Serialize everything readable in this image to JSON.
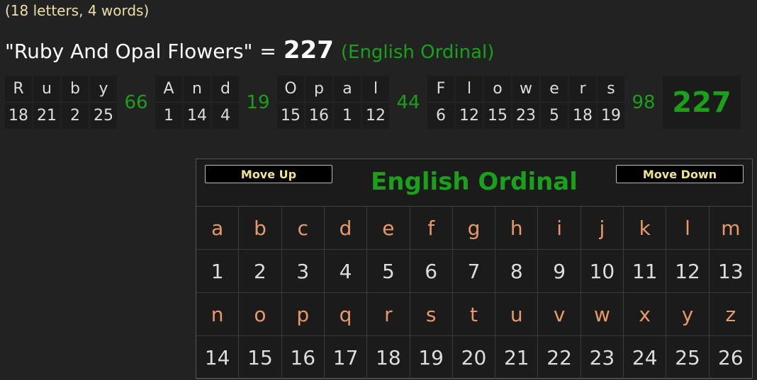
{
  "summary": "(18 letters, 4 words)",
  "phrase": {
    "text": "\"Ruby And Opal Flowers\"",
    "equals": "=",
    "total": "227",
    "cipher_label": "(English Ordinal)"
  },
  "breakdown": {
    "words": [
      {
        "letters": [
          {
            "ch": "R",
            "val": "18"
          },
          {
            "ch": "u",
            "val": "21"
          },
          {
            "ch": "b",
            "val": "2"
          },
          {
            "ch": "y",
            "val": "25"
          }
        ],
        "sum": "66"
      },
      {
        "letters": [
          {
            "ch": "A",
            "val": "1"
          },
          {
            "ch": "n",
            "val": "14"
          },
          {
            "ch": "d",
            "val": "4"
          }
        ],
        "sum": "19"
      },
      {
        "letters": [
          {
            "ch": "O",
            "val": "15"
          },
          {
            "ch": "p",
            "val": "16"
          },
          {
            "ch": "a",
            "val": "1"
          },
          {
            "ch": "l",
            "val": "12"
          }
        ],
        "sum": "44"
      },
      {
        "letters": [
          {
            "ch": "F",
            "val": "6"
          },
          {
            "ch": "l",
            "val": "12"
          },
          {
            "ch": "o",
            "val": "15"
          },
          {
            "ch": "w",
            "val": "23"
          },
          {
            "ch": "e",
            "val": "5"
          },
          {
            "ch": "r",
            "val": "18"
          },
          {
            "ch": "s",
            "val": "19"
          }
        ],
        "sum": "98"
      }
    ],
    "grand_total": "227"
  },
  "cipher_panel": {
    "move_up_label": "Move Up",
    "move_down_label": "Move Down",
    "title": "English Ordinal",
    "rows": [
      {
        "letters": [
          "a",
          "b",
          "c",
          "d",
          "e",
          "f",
          "g",
          "h",
          "i",
          "j",
          "k",
          "l",
          "m"
        ],
        "values": [
          "1",
          "2",
          "3",
          "4",
          "5",
          "6",
          "7",
          "8",
          "9",
          "10",
          "11",
          "12",
          "13"
        ]
      },
      {
        "letters": [
          "n",
          "o",
          "p",
          "q",
          "r",
          "s",
          "t",
          "u",
          "v",
          "w",
          "x",
          "y",
          "z"
        ],
        "values": [
          "14",
          "15",
          "16",
          "17",
          "18",
          "19",
          "20",
          "21",
          "22",
          "23",
          "24",
          "25",
          "26"
        ]
      }
    ]
  },
  "colors": {
    "background": "#222222",
    "accent_green": "#1aa01a",
    "letter_orange": "#e8996a",
    "button_text": "#f1e48f"
  }
}
